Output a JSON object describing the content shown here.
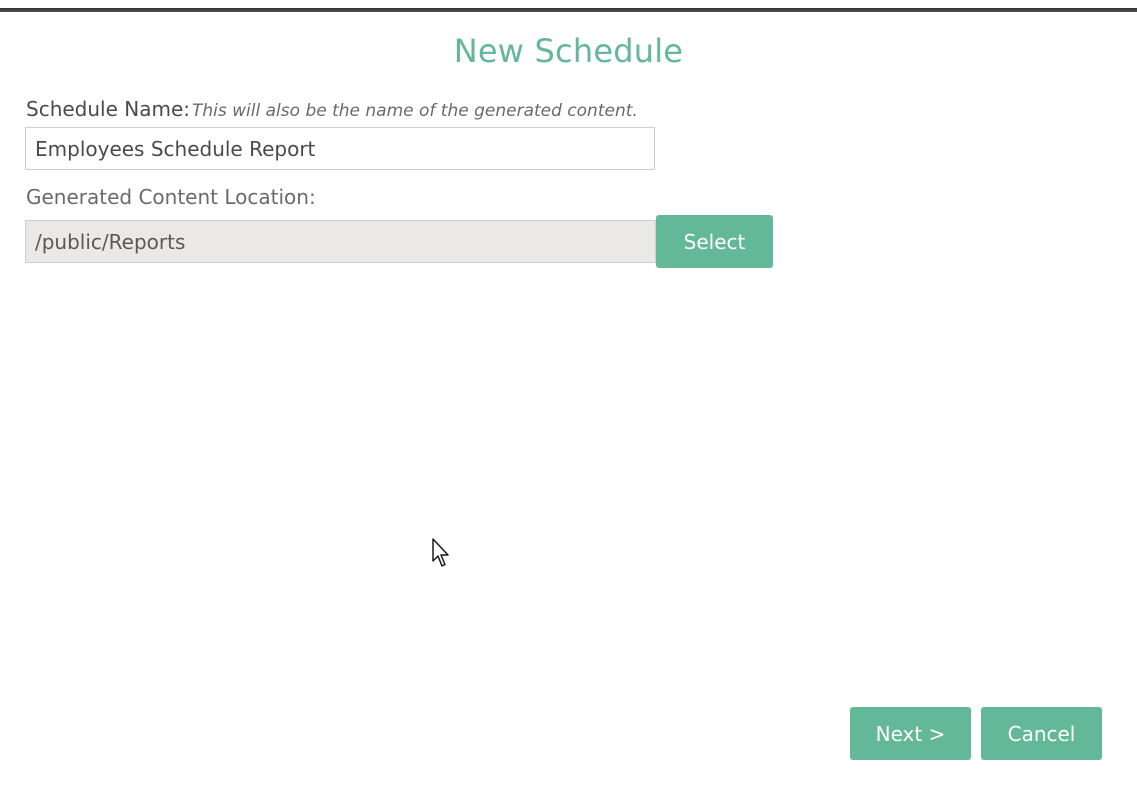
{
  "dialog": {
    "title": "New Schedule"
  },
  "form": {
    "schedule_name": {
      "label": "Schedule Name:",
      "hint": "This will also be the name of the generated content.",
      "value": "Employees Schedule Report"
    },
    "content_location": {
      "label": "Generated Content Location:",
      "value": "/public/Reports"
    },
    "select_label": "Select"
  },
  "footer": {
    "next_label": "Next >",
    "cancel_label": "Cancel"
  },
  "colors": {
    "accent": "#63b89a",
    "readonly_bg": "#ebe9e5"
  },
  "icons": {
    "cursor": "mouse-pointer-icon"
  }
}
